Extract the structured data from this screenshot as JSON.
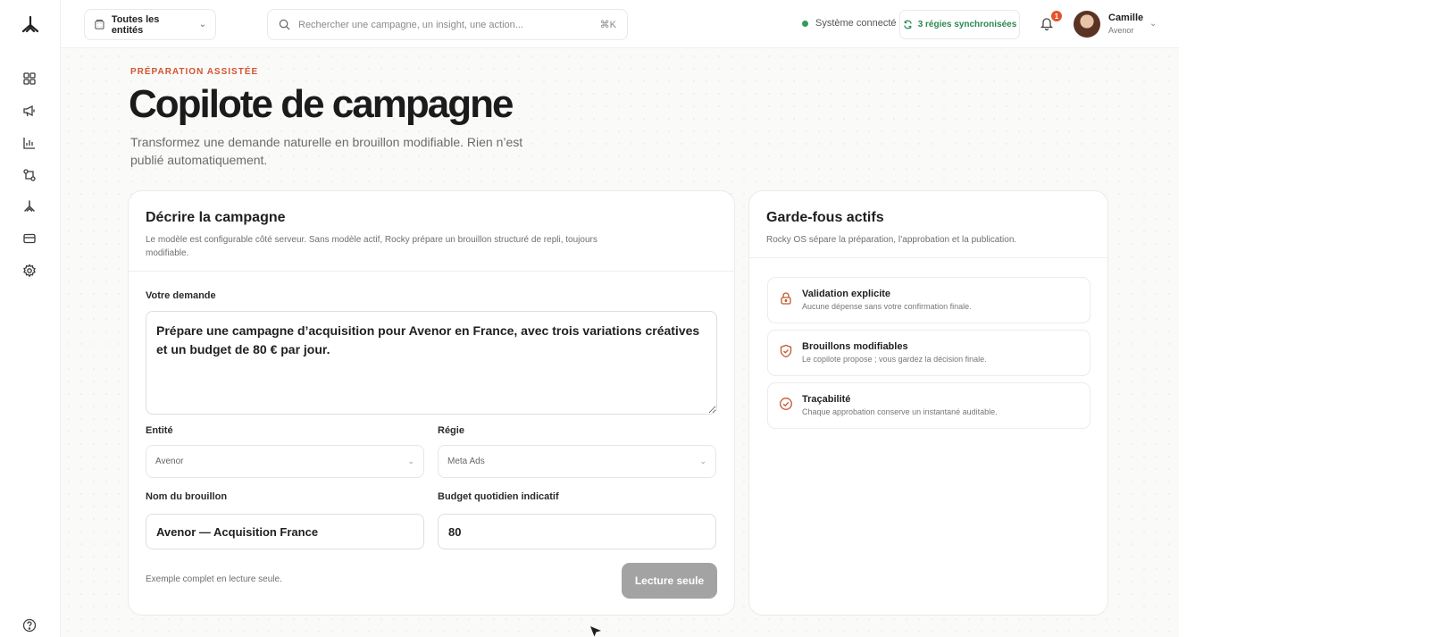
{
  "topbar": {
    "entity_select": "Toutes les entités",
    "search_placeholder": "Rechercher une campagne, un insight, une action...",
    "search_shortcut": "⌘K",
    "status": "Système connecté",
    "sync": "3 régies synchronisées",
    "notifications_count": "1",
    "user": {
      "name": "Camille",
      "org": "Avenor"
    }
  },
  "sidebar": {
    "items": [
      "dashboard-icon",
      "megaphone-icon",
      "chart-icon",
      "workflow-icon",
      "rocky-icon",
      "card-icon",
      "settings-icon"
    ],
    "help_icon": "help-icon"
  },
  "header": {
    "eyebrow": "PRÉPARATION ASSISTÉE",
    "title": "Copilote de campagne",
    "subtitle": "Transformez une demande naturelle en brouillon modifiable. Rien n’est publié automatiquement."
  },
  "main_card": {
    "title": "Décrire la campagne",
    "description": "Le modèle est configurable côté serveur. Sans modèle actif, Rocky prépare un brouillon structuré de repli, toujours modifiable.",
    "request_label": "Votre demande",
    "request_value": "Prépare une campagne d’acquisition pour Avenor en France, avec trois variations créatives et un budget de 80 € par jour.",
    "entity_label": "Entité",
    "entity_value": "Avenor",
    "platform_label": "Régie",
    "platform_value": "Meta Ads",
    "draft_name_label": "Nom du brouillon",
    "draft_name_value": "Avenor — Acquisition France",
    "budget_label": "Budget quotidien indicatif",
    "budget_value": "80",
    "footnote": "Exemple complet en lecture seule.",
    "button": "Lecture seule"
  },
  "side_card": {
    "title": "Garde-fous actifs",
    "description": "Rocky OS sépare la préparation, l’approbation et la publication.",
    "items": [
      {
        "icon": "lock-icon",
        "title": "Validation explicite",
        "desc": "Aucune dépense sans votre confirmation finale."
      },
      {
        "icon": "shield-icon",
        "title": "Brouillons modifiables",
        "desc": "Le copilote propose ; vous gardez la décision finale."
      },
      {
        "icon": "check-circle-icon",
        "title": "Traçabilité",
        "desc": "Chaque approbation conserve un instantané auditable."
      }
    ]
  },
  "colors": {
    "accent": "#d2552f",
    "success": "#2e9e5b",
    "disabled_button": "#a3a3a3"
  }
}
